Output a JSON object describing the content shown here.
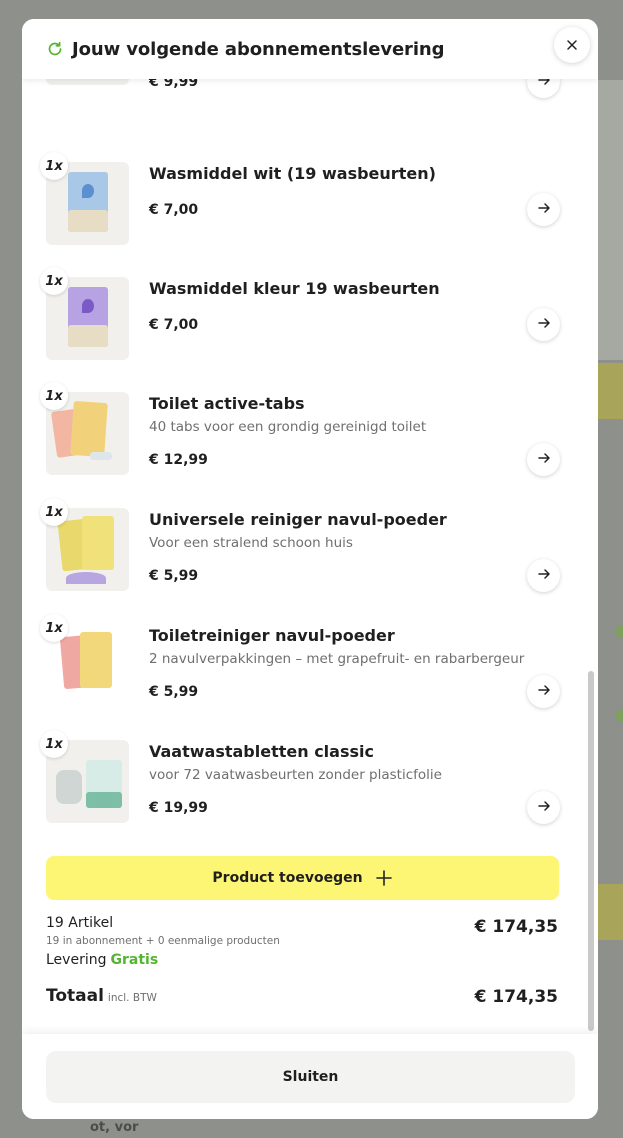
{
  "modal": {
    "title": "Jouw volgende abonnementslevering",
    "close_icon": "close-icon",
    "refresh_icon": "refresh-icon",
    "accent_color": "#55b432"
  },
  "items": [
    {
      "qty": "",
      "name": "",
      "description": "",
      "price": "€ 9,99"
    },
    {
      "qty": "1x",
      "name": "Wasmiddel wit (19 wasbeurten)",
      "description": "",
      "price": "€ 7,00"
    },
    {
      "qty": "1x",
      "name": "Wasmiddel kleur 19 wasbeurten",
      "description": "",
      "price": "€ 7,00"
    },
    {
      "qty": "1x",
      "name": "Toilet active-tabs",
      "description": "40 tabs voor een grondig gereinigd toilet",
      "price": "€ 12,99"
    },
    {
      "qty": "1x",
      "name": "Universele reiniger navul-poeder",
      "description": "Voor een stralend schoon huis",
      "price": "€ 5,99"
    },
    {
      "qty": "1x",
      "name": "Toiletreiniger navul-poeder",
      "description": "2 navulverpakkingen – met grapefruit- en rabarbergeur",
      "price": "€ 5,99"
    },
    {
      "qty": "1x",
      "name": "Vaatwastabletten classic",
      "description": "voor 72 vaatwasbeurten zonder plasticfolie",
      "price": "€ 19,99"
    }
  ],
  "add_product": {
    "label": "Product toevoegen",
    "icon": "plus-icon",
    "color": "#fdf574"
  },
  "summary": {
    "count_label": "19 Artikel",
    "sub_label": "19 in abonnement + 0 eenmalige producten",
    "delivery_label": "Levering",
    "delivery_value": "Gratis",
    "subtotal": "€ 174,35",
    "total_label": "Totaal",
    "total_note": "incl. BTW",
    "total": "€ 174,35"
  },
  "footer": {
    "close_label": "Sluiten"
  },
  "backdrop": {
    "bottom_text": "ot, vor"
  }
}
